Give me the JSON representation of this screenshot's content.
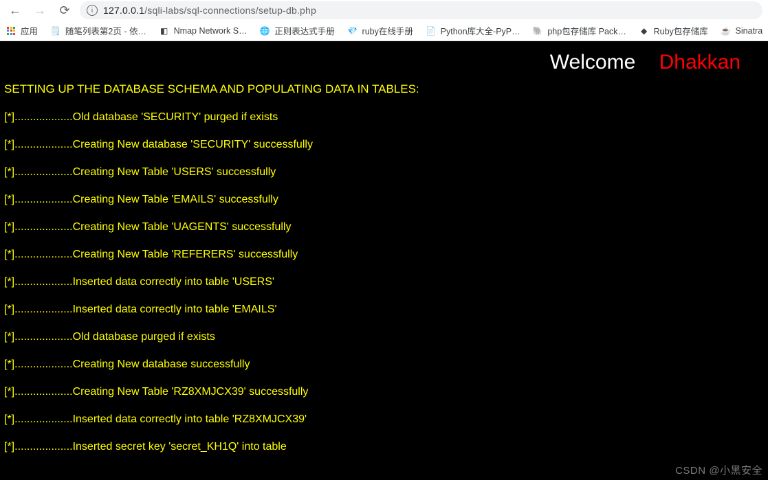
{
  "browser": {
    "url_host": "127.0.0.1",
    "url_path": "/sqli-labs/sql-connections/setup-db.php"
  },
  "bookmarks": {
    "apps_label": "应用",
    "items": [
      {
        "icon": "🗒️",
        "label": "随笔列表第2页 - 依…"
      },
      {
        "icon": "◧",
        "label": "Nmap Network S…"
      },
      {
        "icon": "🌐",
        "label": "正则表达式手册"
      },
      {
        "icon": "💎",
        "label": "ruby在线手册"
      },
      {
        "icon": "📄",
        "label": "Python库大全-PyP…"
      },
      {
        "icon": "🐘",
        "label": "php包存储库 Pack…"
      },
      {
        "icon": "◆",
        "label": "Ruby包存储库"
      },
      {
        "icon": "☕",
        "label": "Sinatra"
      }
    ]
  },
  "page": {
    "welcome": "Welcome",
    "dhakkan": "Dhakkan",
    "heading": "SETTING UP THE DATABASE SCHEMA AND POPULATING DATA IN TABLES:",
    "log_prefix": "[*]...................",
    "logs": [
      "Old database 'SECURITY' purged if exists",
      "Creating New database 'SECURITY' successfully",
      "Creating New Table 'USERS' successfully",
      "Creating New Table 'EMAILS' successfully",
      "Creating New Table 'UAGENTS' successfully",
      "Creating New Table 'REFERERS' successfully",
      "Inserted data correctly into table 'USERS'",
      "Inserted data correctly into table 'EMAILS'",
      "Old database purged if exists",
      "Creating New database successfully",
      "Creating New Table 'RZ8XMJCX39' successfully",
      "Inserted data correctly into table 'RZ8XMJCX39'",
      "Inserted secret key 'secret_KH1Q' into table"
    ]
  },
  "watermark": "CSDN @小黑安全"
}
